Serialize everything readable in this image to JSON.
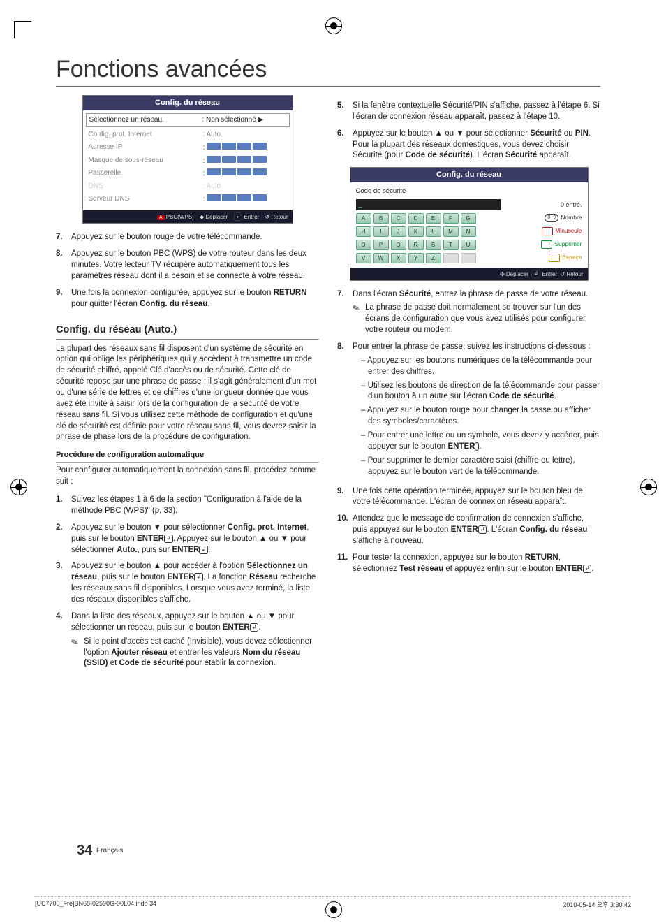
{
  "title": "Fonctions avancées",
  "panel1": {
    "title": "Config. du réseau",
    "rows": {
      "select_net": "Sélectionnez un réseau.",
      "select_net_val": ": Non sélectionné  ▶",
      "prot": "Config. prot. Internet",
      "prot_val": ": Auto.",
      "ip": "Adresse IP",
      "mask": "Masque de sous-réseau",
      "gw": "Passerelle",
      "dns": "DNS",
      "dns_val": ": Auto.",
      "dnsserver": "Serveur DNS"
    },
    "footer": {
      "a": "A",
      "pbc": "PBC(WPS)",
      "move": "Déplacer",
      "enter": "Entrer",
      "return": "Retour"
    }
  },
  "left": {
    "s7": "Appuyez sur le bouton rouge de votre télécommande.",
    "s8": "Appuyez sur le bouton PBC (WPS) de votre routeur dans les deux minutes. Votre lecteur TV récupère automatiquement tous les paramètres réseau dont il a besoin et se connecte à votre réseau.",
    "s9_a": "Une fois la connexion configurée, appuyez sur le bouton ",
    "s9_b": "RETURN",
    "s9_c": " pour quitter l'écran ",
    "s9_d": "Config. du réseau",
    "section": "Config. du réseau (Auto.)",
    "intro": "La plupart des réseaux sans fil disposent d'un système de sécurité en option qui oblige les périphériques qui y accèdent à transmettre un code de sécurité chiffré, appelé Clé d'accès ou de sécurité. Cette clé de sécurité repose sur une phrase de passe ; il s'agit généralement d'un mot ou d'une série de lettres et de chiffres d'une longueur donnée que vous avez été invité à saisir lors de la configuration de la sécurité de votre réseau sans fil. Si vous utilisez cette méthode de configuration et qu'une clé de sécurité est définie pour votre réseau sans fil, vous devrez saisir la phrase de phase lors de la procédure de configuration.",
    "subhead": "Procédure de configuration automatique",
    "intro2": "Pour configurer automatiquement la connexion sans fil, procédez comme suit :",
    "a1": "Suivez les étapes 1 à 6 de la section \"Configuration à l'aide de la méthode PBC (WPS)\" (p. 33).",
    "a2_a": "Appuyez sur le bouton ▼ pour sélectionner ",
    "a2_b": "Config. prot. Internet",
    "a2_c": ", puis sur le bouton ",
    "a2_d": "ENTER",
    "a2_e": ". Appuyez sur le bouton ▲ ou ▼ pour sélectionner ",
    "a2_f": "Auto.",
    "a2_g": ", puis sur ",
    "a3_a": "Appuyez sur le bouton ▲ pour accéder à l'option ",
    "a3_b": "Sélectionnez un réseau",
    "a3_c": ", puis sur le bouton ",
    "a3_d": ". La fonction ",
    "a3_e": "Réseau",
    "a3_f": " recherche les réseaux sans fil disponibles. Lorsque vous avez terminé, la liste des réseaux disponibles s'affiche.",
    "a4_a": "Dans la liste des réseaux, appuyez sur le bouton ▲ ou ▼ pour sélectionner un réseau, puis sur le bouton ",
    "a4_note_a": "Si le point d'accès est caché (Invisible), vous devez sélectionner l'option ",
    "a4_note_b": "Ajouter réseau",
    "a4_note_c": " et entrer les valeurs ",
    "a4_note_d": "Nom du réseau (SSID)",
    "a4_note_e": " et ",
    "a4_note_f": "Code de sécurité",
    "a4_note_g": " pour établir la connexion."
  },
  "right": {
    "s5_a": "Si la fenêtre contextuelle Sécurité/PIN s'affiche, passez à l'étape 6. Si l'écran de connexion réseau apparaît, passez à l'étape 10.",
    "s6_a": "Appuyez sur le bouton ▲ ou ▼ pour sélectionner ",
    "s6_b": "Sécurité",
    "s6_c": " ou ",
    "s6_d": "PIN",
    "s6_e": ". Pour la plupart des réseaux domestiques, vous devez choisir Sécurité (pour ",
    "s6_f": "Code de sécurité",
    "s6_g": "). L'écran ",
    "s6_h": "Sécurité",
    "s6_i": " apparaît.",
    "panel2": {
      "title": "Config. du réseau",
      "code": "Code de sécurité",
      "cursor": "_",
      "entered": "0 entré.",
      "side": {
        "num": "Nombre",
        "min": "Minuscule",
        "sup": "Supprimer",
        "esp": "Espace"
      },
      "footer": {
        "move": "Déplacer",
        "enter": "Entrer",
        "return": "Retour"
      }
    },
    "s7_a": "Dans l'écran ",
    "s7_b": "Sécurité",
    "s7_c": ", entrez la phrase de passe de votre réseau.",
    "s7_note": "La phrase de passe doit normalement se trouver sur l'un des écrans de configuration que vous avez utilisés pour configurer votre routeur ou modem.",
    "s8_a": "Pour entrer la phrase de passe, suivez les instructions ci-dessous :",
    "s8_d1": "Appuyez sur les boutons numériques de la télécommande pour entrer des chiffres.",
    "s8_d2_a": "Utilisez les boutons de direction de la télécommande pour passer d'un bouton à un autre sur l'écran ",
    "s8_d2_b": "Code de sécurité",
    "s8_d3": "Appuyez sur le bouton rouge pour changer la casse ou afficher des symboles/caractères.",
    "s8_d4_a": "Pour entrer une lettre ou un symbole, vous devez y accéder, puis appuyer sur le bouton ",
    "s8_d4_b": "ENTER",
    "s8_d5": "Pour supprimer le dernier caractère saisi (chiffre ou lettre), appuyez sur le bouton vert de la télécommande.",
    "s9": "Une fois cette opération terminée, appuyez sur le bouton bleu de votre télécommande. L'écran de connexion réseau apparaît.",
    "s10_a": "Attendez que le message de confirmation de connexion s'affiche, puis appuyez sur le bouton ",
    "s10_b": "ENTER",
    "s10_c": ". L'écran ",
    "s10_d": "Config. du réseau",
    "s10_e": " s'affiche à nouveau.",
    "s11_a": "Pour tester la connexion, appuyez sur le bouton ",
    "s11_b": "RETURN",
    "s11_c": ", sélectionnez ",
    "s11_d": "Test réseau",
    "s11_e": " et appuyez enfin sur le bouton ",
    "s11_f": "ENTER"
  },
  "pagefoot": {
    "num": "34",
    "lang": "Français"
  },
  "printfoot": {
    "file": "[UC7700_Fre]BN68-02590G-00L04.indb   34",
    "stamp": "2010-05-14   오후 3:30:42"
  },
  "keys": {
    "r1": [
      "A",
      "B",
      "C",
      "D",
      "E",
      "F",
      "G"
    ],
    "r2": [
      "H",
      "I",
      "J",
      "K",
      "L",
      "M",
      "N"
    ],
    "r3": [
      "O",
      "P",
      "Q",
      "R",
      "S",
      "T",
      "U"
    ],
    "r4": [
      "V",
      "W",
      "X",
      "Y",
      "Z",
      "",
      ""
    ]
  },
  "sym": {
    "num_pre": "0~9",
    "down": "▼",
    "up_down": "◆",
    "enter_sym": "↲",
    "return_sym": "↺",
    "move4": "✢"
  }
}
